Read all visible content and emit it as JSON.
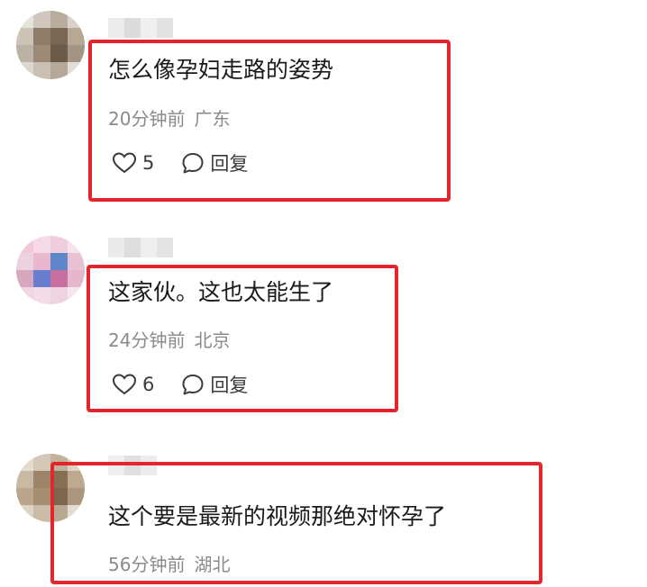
{
  "comments": [
    {
      "text": "怎么像孕妇走路的姿势",
      "time": "20分钟前",
      "location": "广东",
      "likes": "5",
      "reply_label": "回复"
    },
    {
      "text": "这家伙。这也太能生了",
      "time": "24分钟前",
      "location": "北京",
      "likes": "6",
      "reply_label": "回复"
    },
    {
      "text": "这个要是最新的视频那绝对怀孕了",
      "time": "56分钟前",
      "location": "湖北"
    }
  ],
  "icons": {
    "like": "heart-outline-icon",
    "reply": "speech-bubble-icon"
  },
  "colors": {
    "highlight_border": "#e3262e",
    "meta_text": "#8a8a8a",
    "body_text": "#1a1a1a"
  }
}
